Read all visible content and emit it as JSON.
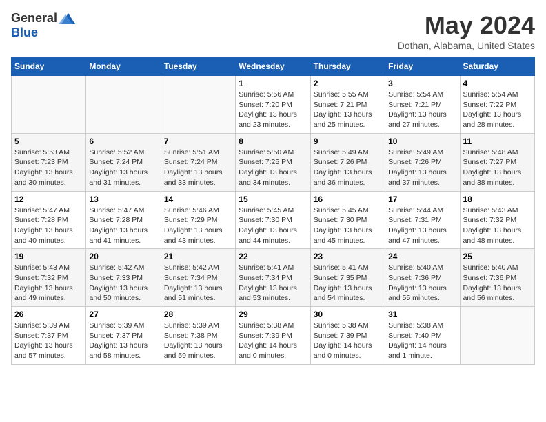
{
  "logo": {
    "general": "General",
    "blue": "Blue"
  },
  "title": "May 2024",
  "location": "Dothan, Alabama, United States",
  "days_header": [
    "Sunday",
    "Monday",
    "Tuesday",
    "Wednesday",
    "Thursday",
    "Friday",
    "Saturday"
  ],
  "weeks": [
    [
      {
        "day": "",
        "info": ""
      },
      {
        "day": "",
        "info": ""
      },
      {
        "day": "",
        "info": ""
      },
      {
        "day": "1",
        "sunrise": "5:56 AM",
        "sunset": "7:20 PM",
        "daylight": "13 hours and 23 minutes."
      },
      {
        "day": "2",
        "sunrise": "5:55 AM",
        "sunset": "7:21 PM",
        "daylight": "13 hours and 25 minutes."
      },
      {
        "day": "3",
        "sunrise": "5:54 AM",
        "sunset": "7:21 PM",
        "daylight": "13 hours and 27 minutes."
      },
      {
        "day": "4",
        "sunrise": "5:54 AM",
        "sunset": "7:22 PM",
        "daylight": "13 hours and 28 minutes."
      }
    ],
    [
      {
        "day": "5",
        "sunrise": "5:53 AM",
        "sunset": "7:23 PM",
        "daylight": "13 hours and 30 minutes."
      },
      {
        "day": "6",
        "sunrise": "5:52 AM",
        "sunset": "7:24 PM",
        "daylight": "13 hours and 31 minutes."
      },
      {
        "day": "7",
        "sunrise": "5:51 AM",
        "sunset": "7:24 PM",
        "daylight": "13 hours and 33 minutes."
      },
      {
        "day": "8",
        "sunrise": "5:50 AM",
        "sunset": "7:25 PM",
        "daylight": "13 hours and 34 minutes."
      },
      {
        "day": "9",
        "sunrise": "5:49 AM",
        "sunset": "7:26 PM",
        "daylight": "13 hours and 36 minutes."
      },
      {
        "day": "10",
        "sunrise": "5:49 AM",
        "sunset": "7:26 PM",
        "daylight": "13 hours and 37 minutes."
      },
      {
        "day": "11",
        "sunrise": "5:48 AM",
        "sunset": "7:27 PM",
        "daylight": "13 hours and 38 minutes."
      }
    ],
    [
      {
        "day": "12",
        "sunrise": "5:47 AM",
        "sunset": "7:28 PM",
        "daylight": "13 hours and 40 minutes."
      },
      {
        "day": "13",
        "sunrise": "5:47 AM",
        "sunset": "7:28 PM",
        "daylight": "13 hours and 41 minutes."
      },
      {
        "day": "14",
        "sunrise": "5:46 AM",
        "sunset": "7:29 PM",
        "daylight": "13 hours and 43 minutes."
      },
      {
        "day": "15",
        "sunrise": "5:45 AM",
        "sunset": "7:30 PM",
        "daylight": "13 hours and 44 minutes."
      },
      {
        "day": "16",
        "sunrise": "5:45 AM",
        "sunset": "7:30 PM",
        "daylight": "13 hours and 45 minutes."
      },
      {
        "day": "17",
        "sunrise": "5:44 AM",
        "sunset": "7:31 PM",
        "daylight": "13 hours and 47 minutes."
      },
      {
        "day": "18",
        "sunrise": "5:43 AM",
        "sunset": "7:32 PM",
        "daylight": "13 hours and 48 minutes."
      }
    ],
    [
      {
        "day": "19",
        "sunrise": "5:43 AM",
        "sunset": "7:32 PM",
        "daylight": "13 hours and 49 minutes."
      },
      {
        "day": "20",
        "sunrise": "5:42 AM",
        "sunset": "7:33 PM",
        "daylight": "13 hours and 50 minutes."
      },
      {
        "day": "21",
        "sunrise": "5:42 AM",
        "sunset": "7:34 PM",
        "daylight": "13 hours and 51 minutes."
      },
      {
        "day": "22",
        "sunrise": "5:41 AM",
        "sunset": "7:34 PM",
        "daylight": "13 hours and 53 minutes."
      },
      {
        "day": "23",
        "sunrise": "5:41 AM",
        "sunset": "7:35 PM",
        "daylight": "13 hours and 54 minutes."
      },
      {
        "day": "24",
        "sunrise": "5:40 AM",
        "sunset": "7:36 PM",
        "daylight": "13 hours and 55 minutes."
      },
      {
        "day": "25",
        "sunrise": "5:40 AM",
        "sunset": "7:36 PM",
        "daylight": "13 hours and 56 minutes."
      }
    ],
    [
      {
        "day": "26",
        "sunrise": "5:39 AM",
        "sunset": "7:37 PM",
        "daylight": "13 hours and 57 minutes."
      },
      {
        "day": "27",
        "sunrise": "5:39 AM",
        "sunset": "7:37 PM",
        "daylight": "13 hours and 58 minutes."
      },
      {
        "day": "28",
        "sunrise": "5:39 AM",
        "sunset": "7:38 PM",
        "daylight": "13 hours and 59 minutes."
      },
      {
        "day": "29",
        "sunrise": "5:38 AM",
        "sunset": "7:39 PM",
        "daylight": "14 hours and 0 minutes."
      },
      {
        "day": "30",
        "sunrise": "5:38 AM",
        "sunset": "7:39 PM",
        "daylight": "14 hours and 0 minutes."
      },
      {
        "day": "31",
        "sunrise": "5:38 AM",
        "sunset": "7:40 PM",
        "daylight": "14 hours and 1 minute."
      },
      {
        "day": "",
        "info": ""
      }
    ]
  ]
}
